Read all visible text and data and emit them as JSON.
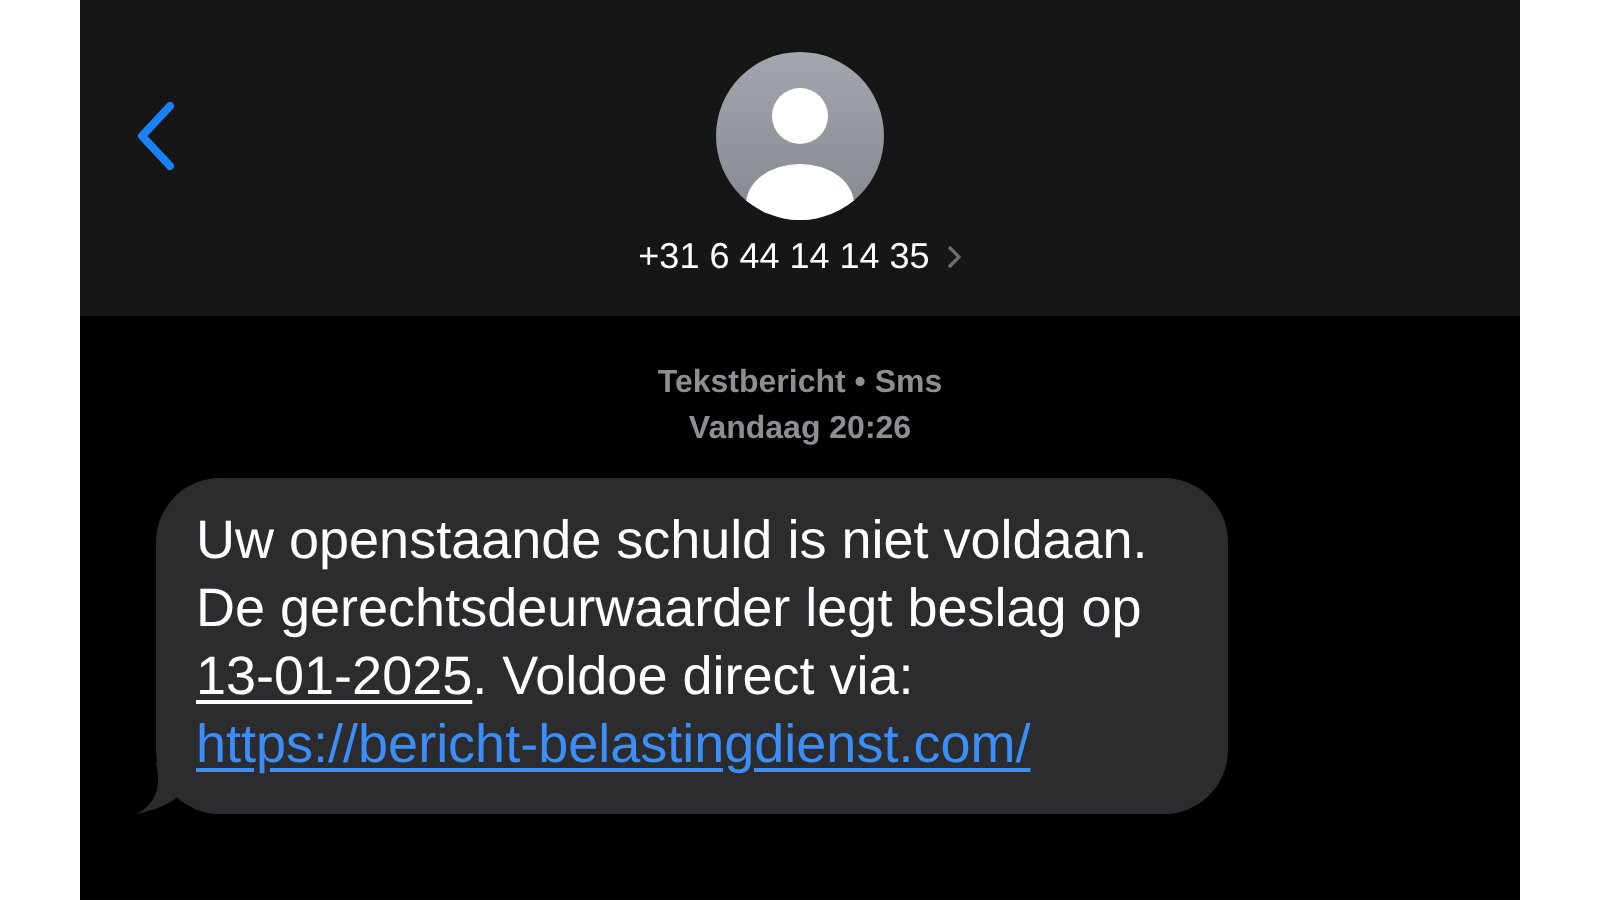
{
  "header": {
    "contact": "+31 6 44 14 14 35"
  },
  "meta": {
    "service": "Tekstbericht • Sms",
    "time": "Vandaag 20:26"
  },
  "message": {
    "parts": [
      {
        "kind": "text",
        "text": "Uw openstaande schuld is niet voldaan. De gerechtsdeurwaarder legt beslag op "
      },
      {
        "kind": "date",
        "text": "13-01-2025"
      },
      {
        "kind": "text",
        "text": ". Voldoe direct via: "
      },
      {
        "kind": "link",
        "text": "https://bericht-belastingdienst.com/"
      }
    ]
  }
}
